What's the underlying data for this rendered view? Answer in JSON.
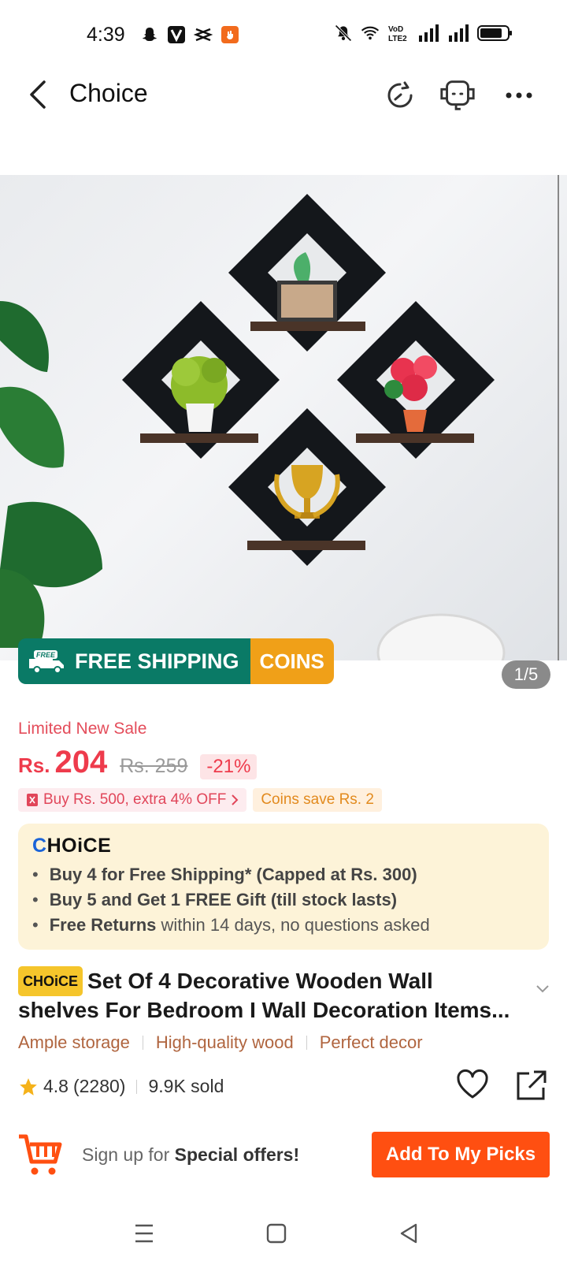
{
  "status": {
    "time": "4:39",
    "left_icons": [
      "snapchat-icon",
      "v-app-icon",
      "capcut-icon",
      "app-notification-icon"
    ],
    "right_icons": [
      "mute-icon",
      "wifi-icon",
      "volte-icon",
      "signal-icon",
      "signal-icon",
      "battery-icon"
    ],
    "volte_text": "VoD LTE2"
  },
  "header": {
    "title": "Choice"
  },
  "hero": {
    "pager": "1/5"
  },
  "badge": {
    "free_shipping": "FREE SHIPPING",
    "free_small": "FREE",
    "coins": "COINS"
  },
  "price": {
    "sale_label": "Limited New Sale",
    "currency": "Rs.",
    "current": "204",
    "original": "Rs. 259",
    "discount": "-21%"
  },
  "promos": {
    "extra_off": "Buy Rs. 500, extra 4% OFF",
    "coins_save": "Coins save Rs. 2"
  },
  "choice": {
    "logo_c": "C",
    "logo_rest": "HOiCE",
    "items": [
      {
        "bold": "Buy 4 for  Free Shipping* (Capped at Rs. 300)",
        "rest": ""
      },
      {
        "bold": "Buy 5 and Get 1 FREE Gift (till stock lasts)",
        "rest": ""
      },
      {
        "bold": "Free Returns",
        "rest": " within 14 days, no questions asked"
      }
    ]
  },
  "product": {
    "tag": "CHOiCE",
    "title": "Set Of 4 Decorative Wooden Wall shelves For Bedroom I Wall Decoration Items..."
  },
  "features": [
    "Ample storage",
    "High-quality wood",
    "Perfect decor"
  ],
  "rating": {
    "score": "4.8",
    "count": "(2280)",
    "sold": "9.9K sold"
  },
  "signup": {
    "prefix": "Sign up for ",
    "bold": "Special offers!",
    "button": "Add To My Picks"
  },
  "colors": {
    "accent": "#ff4f11",
    "price": "#ee3b4c",
    "ship_green": "#0a7a66",
    "coins_orange": "#f0a018",
    "choice_bg": "#fdf3d8"
  }
}
